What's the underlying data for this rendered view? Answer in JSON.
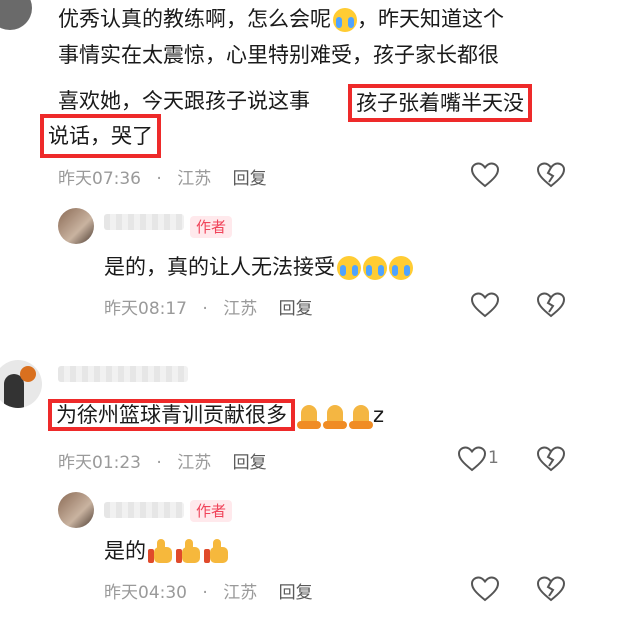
{
  "comments": [
    {
      "text_line1": "优秀认真的教练啊，怎么会呢",
      "text_line1b": "，昨天知道这个",
      "text_line2": "事情实在太震惊，心里特别难受，孩子家长都很",
      "text_line3": "喜欢她，今天跟孩子说这事",
      "highlight_a": "孩子张着嘴半天没",
      "highlight_b": "说话，哭了",
      "time": "昨天07:36",
      "location": "江苏",
      "reply": "回复"
    },
    {
      "tag": "作者",
      "text": "是的，真的让人无法接受",
      "time": "昨天08:17",
      "location": "江苏",
      "reply": "回复"
    },
    {
      "highlight": "为徐州篮球青训贡献很多",
      "suffix": "z",
      "time": "昨天01:23",
      "location": "江苏",
      "reply": "回复",
      "likes": "1"
    },
    {
      "tag": "作者",
      "text": "是的",
      "time": "昨天04:30",
      "location": "江苏",
      "reply": "回复"
    }
  ],
  "separator": "·",
  "icons": {
    "like": "heart-icon",
    "dislike": "broken-heart-icon",
    "cry": "crying-face-emoji",
    "pray": "folded-hands-emoji",
    "thumb": "thumbs-up-emoji"
  }
}
